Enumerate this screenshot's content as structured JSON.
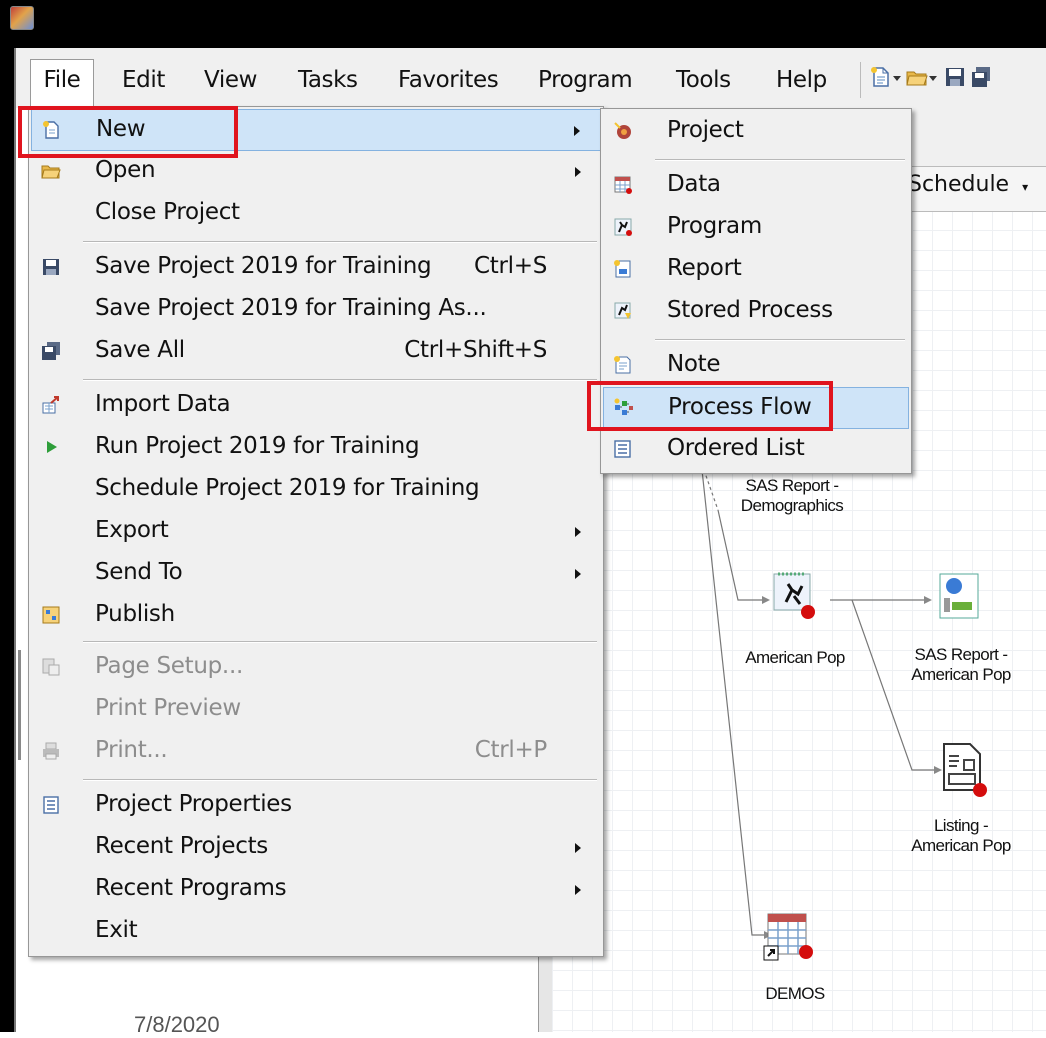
{
  "menubar": {
    "items": [
      "File",
      "Edit",
      "View",
      "Tasks",
      "Favorites",
      "Program",
      "Tools",
      "Help"
    ]
  },
  "file_menu": {
    "items": [
      {
        "label": "New",
        "icon": "new-document-icon"
      },
      {
        "label": "Open",
        "icon": "folder-open-icon"
      },
      {
        "label": "Close Project"
      },
      {
        "label": "Save Project 2019 for Training",
        "shortcut": "Ctrl+S",
        "icon": "save-icon"
      },
      {
        "label": "Save Project 2019 for Training As..."
      },
      {
        "label": "Save All",
        "shortcut": "Ctrl+Shift+S",
        "icon": "save-all-icon"
      },
      {
        "label": "Import Data",
        "icon": "import-data-icon"
      },
      {
        "label": "Run Project 2019 for Training",
        "icon": "run-icon"
      },
      {
        "label": "Schedule Project 2019 for Training"
      },
      {
        "label": "Export"
      },
      {
        "label": "Send To"
      },
      {
        "label": "Publish",
        "icon": "publish-icon"
      },
      {
        "label": "Page Setup...",
        "icon": "page-setup-icon"
      },
      {
        "label": "Print Preview"
      },
      {
        "label": "Print...",
        "shortcut": "Ctrl+P",
        "icon": "print-icon"
      },
      {
        "label": "Project Properties",
        "icon": "properties-icon"
      },
      {
        "label": "Recent Projects"
      },
      {
        "label": "Recent Programs"
      },
      {
        "label": "Exit"
      }
    ]
  },
  "new_menu": {
    "items": [
      {
        "label": "Project",
        "icon": "project-icon"
      },
      {
        "label": "Data",
        "icon": "data-icon"
      },
      {
        "label": "Program",
        "icon": "program-icon"
      },
      {
        "label": "Report",
        "icon": "report-icon"
      },
      {
        "label": "Stored Process",
        "icon": "stored-process-icon"
      },
      {
        "label": "Note",
        "icon": "note-icon"
      },
      {
        "label": "Process Flow",
        "icon": "process-flow-icon"
      },
      {
        "label": "Ordered List",
        "icon": "ordered-list-icon"
      }
    ]
  },
  "workspace": {
    "schedule_label": "Schedule",
    "nodes": {
      "report_demographics": "SAS Report -\nDemographics",
      "american_pop": "American Pop",
      "report_american_pop": "SAS Report -\nAmerican Pop",
      "listing_american_pop": "Listing -\nAmerican Pop",
      "demos": "DEMOS"
    }
  },
  "footer": {
    "date": "7/8/2020"
  },
  "colors": {
    "highlight": "#cfe4f8",
    "annotation_red": "#e0141e"
  }
}
